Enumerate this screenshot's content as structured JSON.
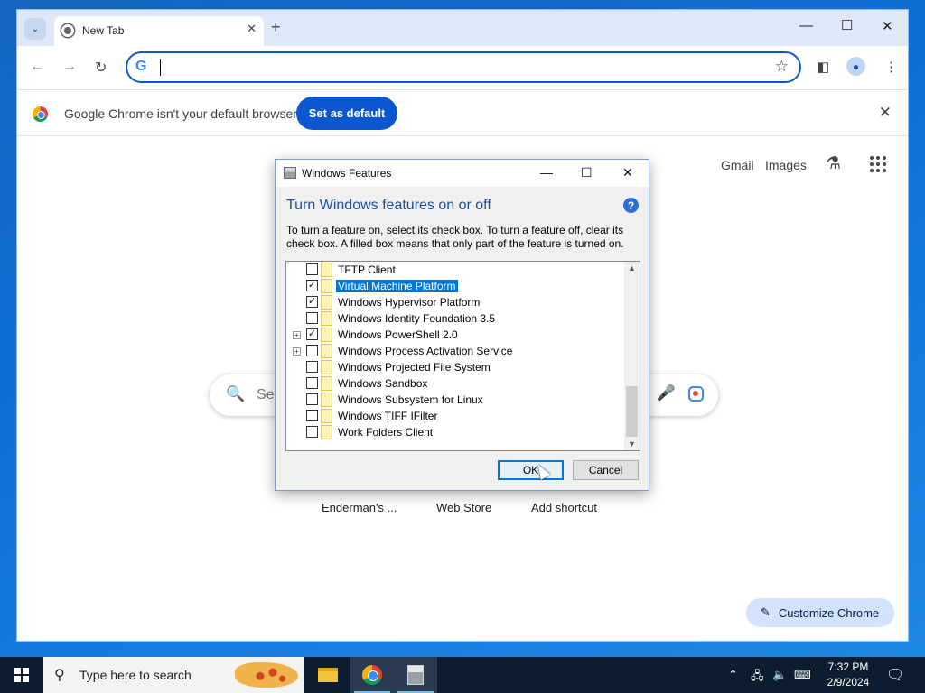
{
  "browser": {
    "tab_title": "New Tab",
    "new_tab_symbol": "+",
    "omnibox_value": "",
    "infobar": {
      "message": "Google Chrome isn't your default browser",
      "button": "Set as default"
    },
    "ntp": {
      "links": [
        "Gmail",
        "Images"
      ],
      "search_placeholder": "Sea",
      "shortcuts": [
        "Enderman's ...",
        "Web Store",
        "Add shortcut"
      ],
      "customize_label": "Customize Chrome"
    },
    "colors": {
      "accent": "#0b57d0",
      "tabstrip": "#dee8f8",
      "customize_bg": "#d3e3fd"
    }
  },
  "dialog": {
    "title": "Windows Features",
    "heading": "Turn Windows features on or off",
    "help_symbol": "?",
    "description": "To turn a feature on, select its check box. To turn a feature off, clear its check box. A filled box means that only part of the feature is turned on.",
    "features": [
      {
        "label": "TFTP Client",
        "checked": false,
        "expandable": false,
        "selected": false
      },
      {
        "label": "Virtual Machine Platform",
        "checked": true,
        "expandable": false,
        "selected": true
      },
      {
        "label": "Windows Hypervisor Platform",
        "checked": true,
        "expandable": false,
        "selected": false
      },
      {
        "label": "Windows Identity Foundation 3.5",
        "checked": false,
        "expandable": false,
        "selected": false
      },
      {
        "label": "Windows PowerShell 2.0",
        "checked": true,
        "expandable": true,
        "selected": false
      },
      {
        "label": "Windows Process Activation Service",
        "checked": false,
        "expandable": true,
        "selected": false
      },
      {
        "label": "Windows Projected File System",
        "checked": false,
        "expandable": false,
        "selected": false
      },
      {
        "label": "Windows Sandbox",
        "checked": false,
        "expandable": false,
        "selected": false
      },
      {
        "label": "Windows Subsystem for Linux",
        "checked": false,
        "expandable": false,
        "selected": false
      },
      {
        "label": "Windows TIFF IFilter",
        "checked": false,
        "expandable": false,
        "selected": false
      },
      {
        "label": "Work Folders Client",
        "checked": false,
        "expandable": false,
        "selected": false
      }
    ],
    "ok_label": "OK",
    "cancel_label": "Cancel",
    "colors": {
      "heading": "#1a4e9e",
      "selection": "#0078d7"
    }
  },
  "taskbar": {
    "search_placeholder": "Type here to search",
    "apps": [
      "file-explorer-icon",
      "chrome-icon",
      "windows-features-icon"
    ],
    "time": "7:32 PM",
    "date": "2/9/2024"
  }
}
